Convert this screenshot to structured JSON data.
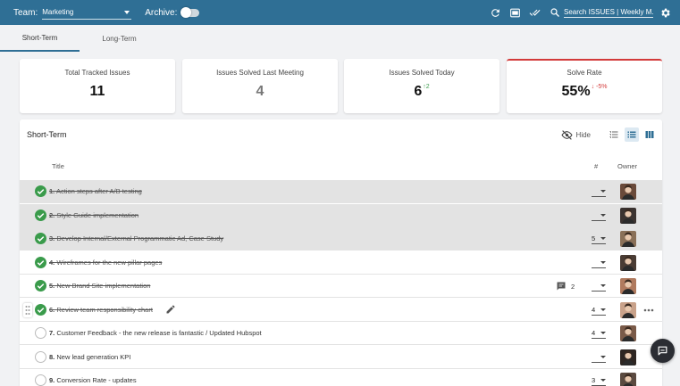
{
  "topbar": {
    "team_label": "Team:",
    "team_value": "Marketing",
    "archive_label": "Archive:",
    "search_placeholder": "Search ISSUES | Weekly M..."
  },
  "tabs": [
    {
      "label": "Short-Term",
      "active": true
    },
    {
      "label": "Long-Term",
      "active": false
    }
  ],
  "kpis": [
    {
      "title": "Total Tracked Issues",
      "value": "11"
    },
    {
      "title": "Issues Solved Last Meeting",
      "value": "4"
    },
    {
      "title": "Issues Solved Today",
      "value": "6",
      "delta": "2",
      "delta_dir": "up"
    },
    {
      "title": "Solve Rate",
      "value": "55%",
      "delta": "-5%",
      "delta_dir": "down"
    }
  ],
  "panel": {
    "title": "Short-Term",
    "hide_label": "Hide",
    "col_title": "Title",
    "col_num": "#",
    "col_owner": "Owner"
  },
  "issues": [
    {
      "n": "1.",
      "title": "Action steps after A/B testing",
      "num": "",
      "done": true,
      "avatar": "#6a4a3a"
    },
    {
      "n": "2.",
      "title": "Style Guide implementation",
      "num": "",
      "done": true,
      "avatar": "#3b3330"
    },
    {
      "n": "3.",
      "title": "Develop Internal/External Programmatic Ad, Case Study",
      "num": "5",
      "done": true,
      "avatar": "#8a7058"
    },
    {
      "n": "4.",
      "title": "Wireframes for the new pillar pages",
      "num": "",
      "done": true,
      "avatar": "#4a3c34"
    },
    {
      "n": "5.",
      "title": "New Brand Site implementation",
      "num": "",
      "done": true,
      "avatar": "#b07a5e",
      "comments": "2"
    },
    {
      "n": "6.",
      "title": "Review team responsibility chart",
      "num": "4",
      "done": true,
      "avatar": "#c9a28a",
      "editing": true
    },
    {
      "n": "7.",
      "title": "Customer Feedback - the new release is fantastic / Updated Hubspot",
      "num": "4",
      "done": false,
      "avatar": "#7a5a48"
    },
    {
      "n": "8.",
      "title": "New lead generation KPI",
      "num": "",
      "done": false,
      "avatar": "#2e2622"
    },
    {
      "n": "9.",
      "title": "Conversion Rate - updates",
      "num": "3",
      "done": false,
      "avatar": "#5b4a40"
    }
  ],
  "colors": {
    "topbar": "#2f6f95",
    "success": "#3a9b4b",
    "danger": "#d33a3a"
  }
}
